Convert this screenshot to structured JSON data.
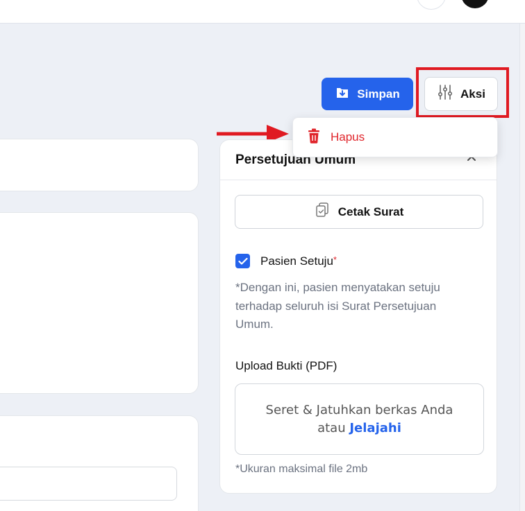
{
  "toolbar": {
    "save_label": "Simpan",
    "action_label": "Aksi",
    "save_icon": "download-box-icon",
    "action_icon": "sliders-icon",
    "save_color": "#2563eb"
  },
  "dropdown": {
    "delete_label": "Hapus",
    "delete_icon": "trash-icon",
    "delete_color": "#e0252b"
  },
  "annotation": {
    "highlight_color": "#e01a22"
  },
  "panel": {
    "title": "Persetujuan Umum",
    "close_icon": "close-icon",
    "print_label": "Cetak Surat",
    "print_icon": "copy-document-icon",
    "checkbox_label": "Pasien Setuju",
    "checkbox_required_mark": "*",
    "checkbox_checked": true,
    "consent_note": "*Dengan ini, pasien menyatakan setuju terhadap seluruh isi Surat Persetujuan Umum.",
    "upload_label": "Upload Bukti (PDF)",
    "dropzone_text": "Seret & Jatuhkan berkas Anda",
    "dropzone_or": "atau",
    "dropzone_link": "Jelajahi",
    "size_note": "*Ukuran maksimal file 2mb"
  }
}
